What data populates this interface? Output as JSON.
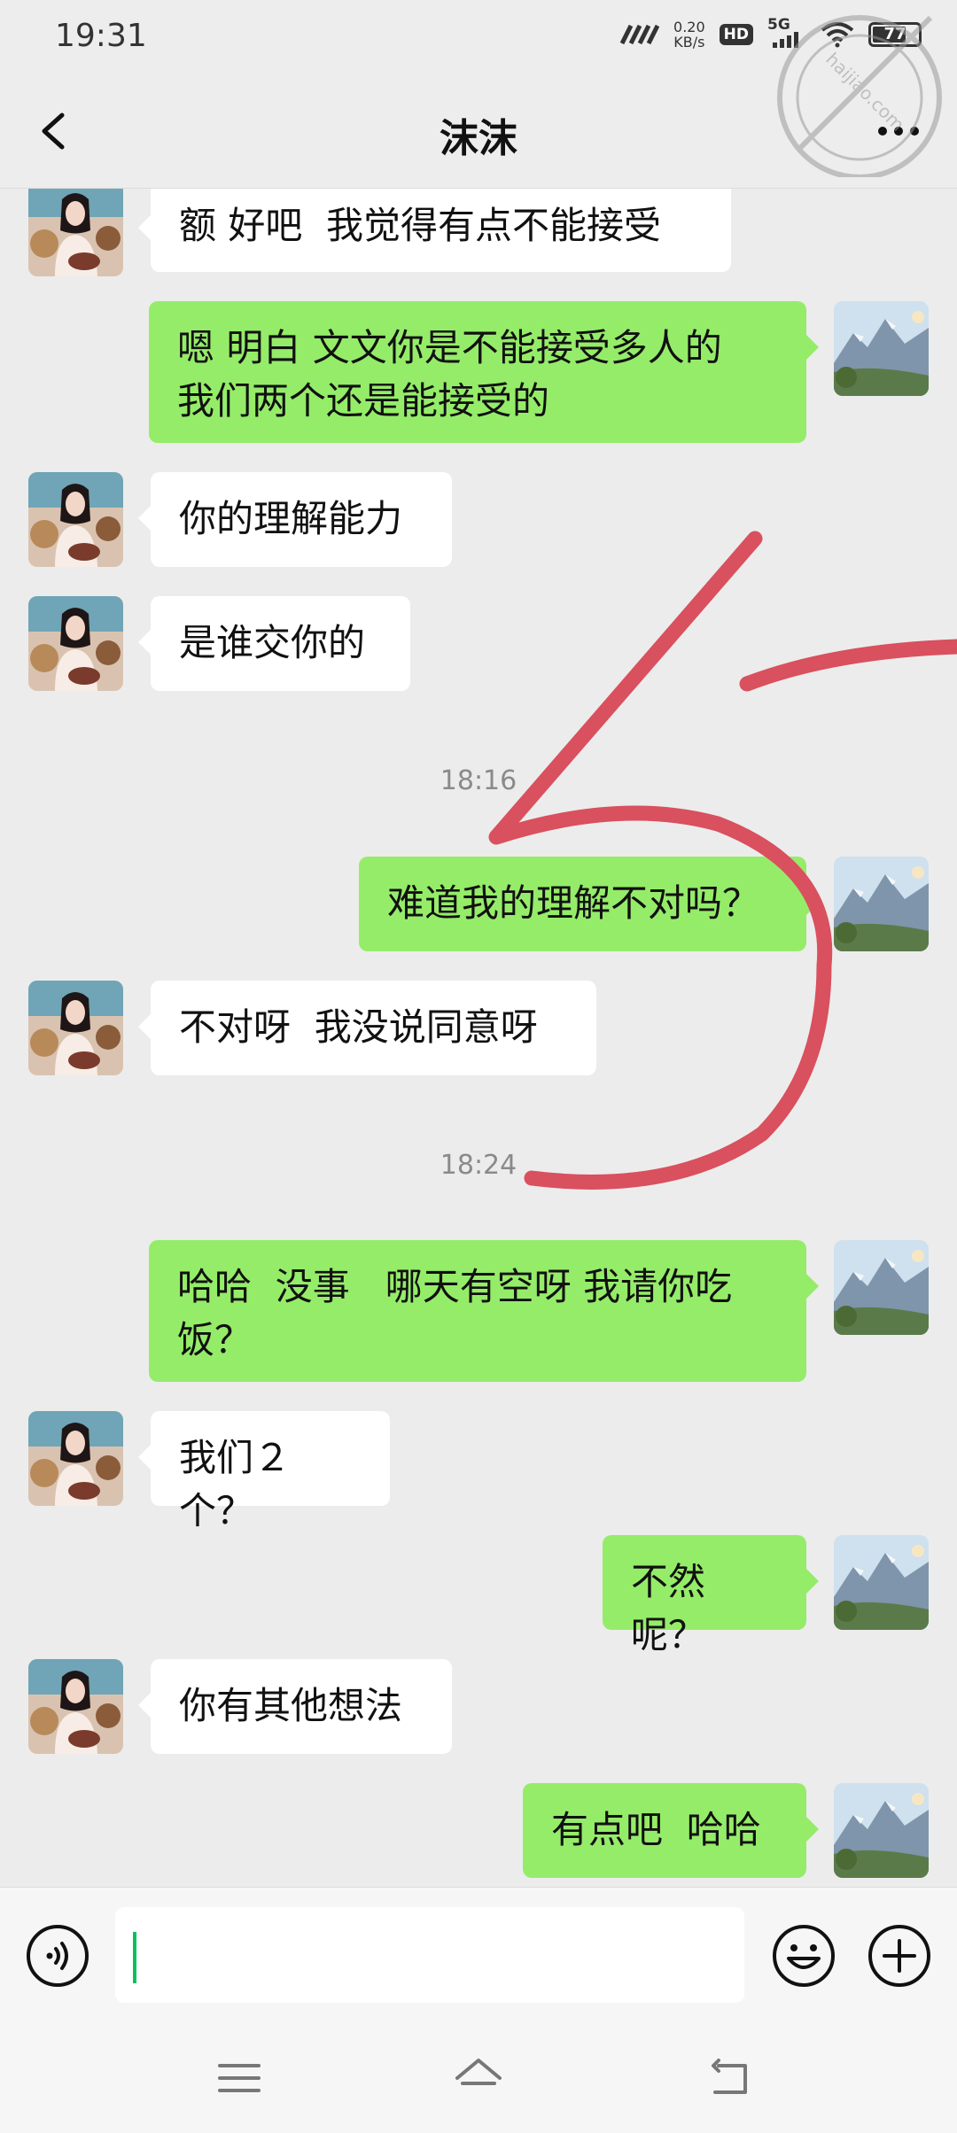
{
  "status_bar": {
    "time": "19:31",
    "net_speed_value": "0.20",
    "net_speed_unit": "KB/s",
    "hd_badge": "HD",
    "network": "5G",
    "battery": "77",
    "battery_level_percent": 77
  },
  "header": {
    "title": "沫沫",
    "back_icon": "chevron-left-icon",
    "more_icon": "more-dots-icon"
  },
  "messages": [
    {
      "side": "left",
      "text": "额 好吧  我觉得有点不能接受"
    },
    {
      "side": "right",
      "text": "嗯 明白 文文你是不能接受多人的\n我们两个还是能接受的"
    },
    {
      "side": "left",
      "text": "你的理解能力"
    },
    {
      "side": "left",
      "text": "是谁交你的"
    },
    {
      "side": "right",
      "text": "难道我的理解不对吗？"
    },
    {
      "side": "left",
      "text": "不对呀  我没说同意呀"
    },
    {
      "side": "right",
      "text": "哈哈  没事   哪天有空呀 我请你吃\n饭？"
    },
    {
      "side": "left",
      "text": "我们２个？"
    },
    {
      "side": "right",
      "text": "不然呢？"
    },
    {
      "side": "left",
      "text": "你有其他想法"
    },
    {
      "side": "right",
      "text": "有点吧  哈哈"
    }
  ],
  "timestamps": [
    "18:16",
    "18:24"
  ],
  "input_bar": {
    "voice_icon": "voice-icon",
    "input_value": "",
    "emoji_icon": "emoji-icon",
    "plus_icon": "plus-icon"
  },
  "system_nav": [
    "menu-icon",
    "home-icon",
    "back-icon"
  ],
  "colors": {
    "background": "#ececec",
    "outgoing_bubble": "#95ec69",
    "incoming_bubble": "#ffffff",
    "annotation_stroke": "#d9505e"
  },
  "watermark_text": "haijiao.com 海角社区"
}
